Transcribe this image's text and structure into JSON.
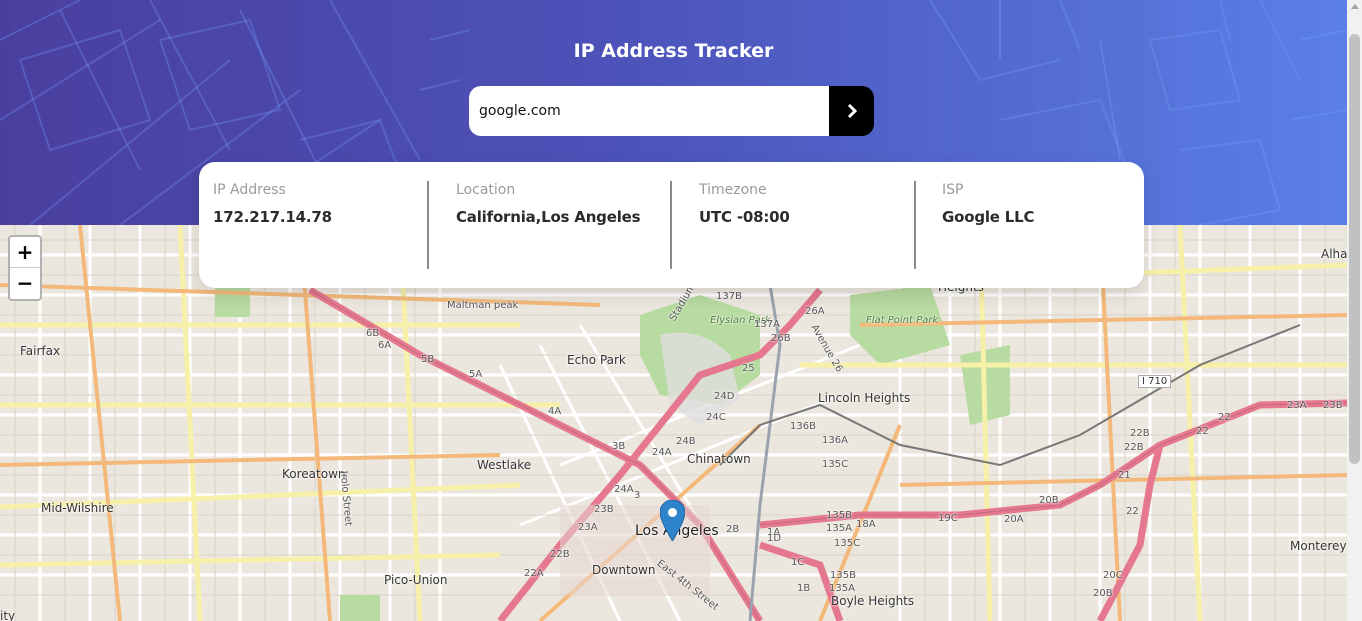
{
  "header": {
    "title": "IP Address Tracker",
    "background_colors": [
      "#4a3f9e",
      "#5a7fe6"
    ]
  },
  "search": {
    "value": "google.com",
    "submit_icon": "chevron-right-icon"
  },
  "info": {
    "ip": {
      "label": "IP Address",
      "value": "172.217.14.78"
    },
    "location": {
      "label": "Location",
      "value": "California,Los Angeles"
    },
    "timezone": {
      "label": "Timezone",
      "value": "UTC -08:00"
    },
    "isp": {
      "label": "ISP",
      "value": "Google LLC"
    }
  },
  "map": {
    "zoom_in": "+",
    "zoom_out": "−",
    "marker_icon": "map-marker-icon",
    "labels": {
      "fairfax": "Fairfax",
      "maltman_peak": "Maltman peak",
      "echo_park": "Echo Park",
      "elysian_park": "Elysian Park",
      "flat_point_park": "Flat Point Park",
      "lincoln_heights": "Lincoln Heights",
      "heights": "Heights",
      "alhambra": "Alha",
      "koreatown": "Koreatown",
      "westlake": "Westlake",
      "chinatown": "Chinatown",
      "mid_wilshire": "Mid-Wilshire",
      "los_angeles": "Los Angeles",
      "downtown": "Downtown",
      "pico_union": "Pico-Union",
      "boyle_heights": "Boyle Heights",
      "monterey": "Monterey",
      "city_partial": "ity",
      "i710": "I 710",
      "stadium": "Stadium",
      "irolo_street": "Irolo Street",
      "east_4th_street": "East 4th Street",
      "avenue_26": "Avenue 26",
      "ex_6a": "6A",
      "ex_6b": "6B",
      "ex_5b": "5B",
      "ex_5a": "5A",
      "ex_4a": "4A",
      "ex_3b": "3B",
      "ex_24a": "24A",
      "ex_23b": "23B",
      "ex_23a": "23A",
      "ex_22b": "22B",
      "ex_22a": "22A",
      "ex_24b": "24B",
      "ex_24c": "24C",
      "ex_24d": "24D",
      "ex_25": "25",
      "ex_26b": "26B",
      "ex_26a": "26A",
      "ex_137b": "137B",
      "ex_137a": "137A",
      "ex_136b": "136B",
      "ex_136a": "136A",
      "ex_135c": "135C",
      "ex_135b": "135B",
      "ex_135a": "135A",
      "ex_1a": "1A",
      "ex_1c": "1C",
      "ex_1d": "1D",
      "ex_1b": "1B",
      "ex_18a": "18A",
      "ex_19c": "19C",
      "ex_20a": "20A",
      "ex_20b": "20B",
      "ex_20c": "20C",
      "ex_21": "21",
      "ex_22": "22",
      "ex_22b2": "22B",
      "ex_22a2": "22A",
      "ex_23a2": "23A",
      "ex_23b2": "23B",
      "ex_2b": "2B",
      "ex_3": "3"
    }
  }
}
